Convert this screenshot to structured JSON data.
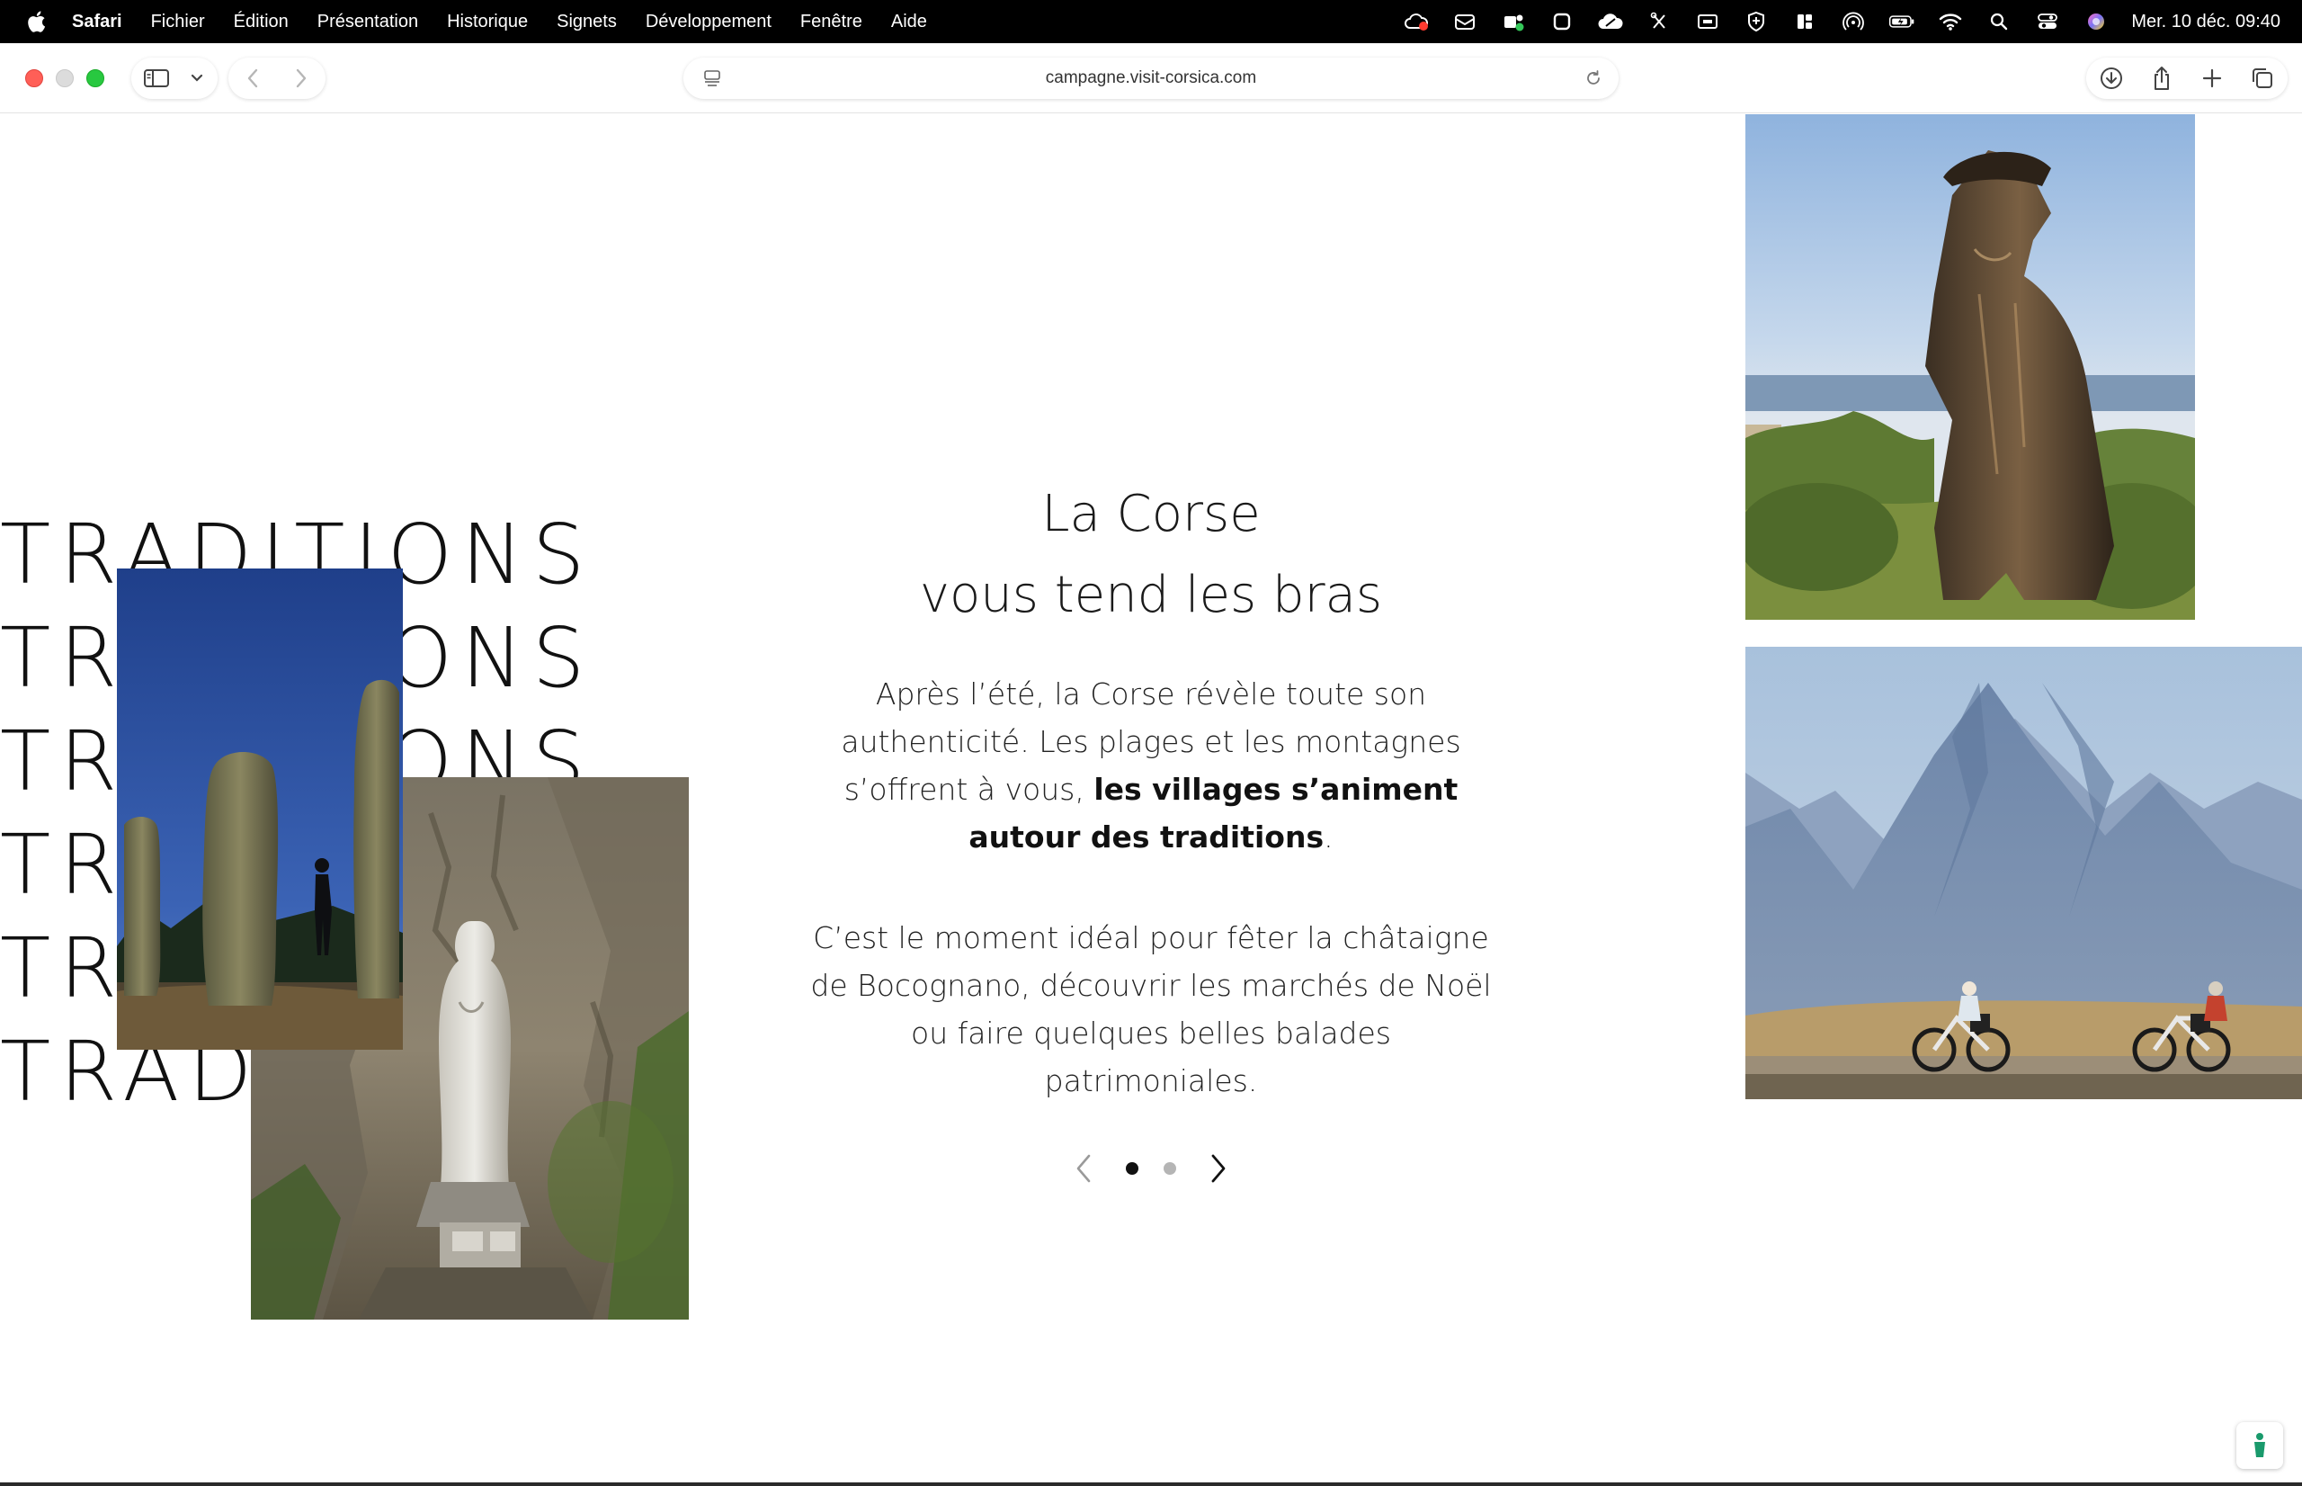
{
  "menubar": {
    "app_name": "Safari",
    "items": [
      "Fichier",
      "Édition",
      "Présentation",
      "Historique",
      "Signets",
      "Développement",
      "Fenêtre",
      "Aide"
    ],
    "clock": "Mer. 10 déc.  09:40"
  },
  "browser": {
    "url": "campagne.visit-corsica.com"
  },
  "hero": {
    "repeated_word": "TRADITIONS",
    "headline_line1": "La Corse",
    "headline_line2": "vous tend les bras",
    "para1_start": "Après l’été, la Corse révèle toute son authenticité. Les plages et les montagnes s’offrent à vous, ",
    "para1_bold": "les villages s’animent autour des traditions",
    "para1_end": ".",
    "para2": "C’est le moment idéal pour fêter la châtaigne de Bocognano, découvrir les marchés de Noël ou faire quelques belles balades patrimoniales."
  },
  "carousel": {
    "total_slides": 2,
    "active_slide": 1
  }
}
